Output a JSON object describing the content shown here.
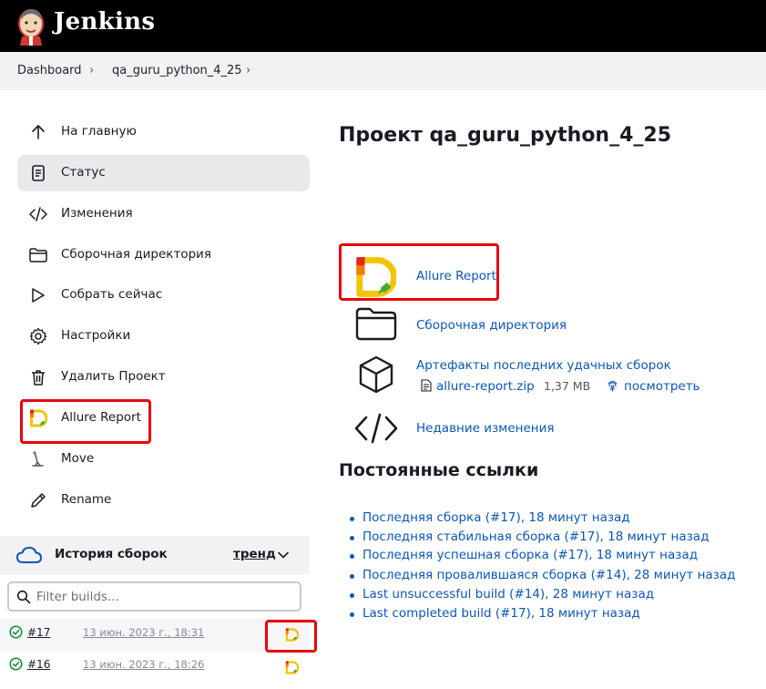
{
  "header": {
    "brand": "Jenkins"
  },
  "breadcrumb": {
    "items": [
      "Dashboard",
      "qa_guru_python_4_25"
    ]
  },
  "sidebar": {
    "items": [
      {
        "label": "На главную",
        "icon": "arrow-up-icon"
      },
      {
        "label": "Статус",
        "icon": "document-icon",
        "active": true
      },
      {
        "label": "Изменения",
        "icon": "code-icon"
      },
      {
        "label": "Сборочная директория",
        "icon": "folder-icon"
      },
      {
        "label": "Собрать сейчас",
        "icon": "play-icon"
      },
      {
        "label": "Настройки",
        "icon": "gear-icon"
      },
      {
        "label": "Удалить Проект",
        "icon": "trash-icon"
      },
      {
        "label": "Allure Report",
        "icon": "allure-icon"
      },
      {
        "label": "Move",
        "icon": "move-icon"
      },
      {
        "label": "Rename",
        "icon": "pencil-icon"
      }
    ]
  },
  "build_history": {
    "title": "История сборок",
    "trend_label": "тренд",
    "filter_placeholder": "Filter builds...",
    "builds": [
      {
        "number": "#17",
        "date": "13 июн. 2023 г., 18:31",
        "status": "success"
      },
      {
        "number": "#16",
        "date": "13 июн. 2023 г., 18:26",
        "status": "success"
      }
    ]
  },
  "main": {
    "title": "Проект qa_guru_python_4_25",
    "links": {
      "allure": "Allure Report",
      "workspace": "Сборочная директория",
      "artifacts": "Артефакты последних удачных сборок",
      "artifact_file": "allure-report.zip",
      "artifact_size": "1,37 MB",
      "artifact_view": "посмотреть",
      "changes": "Недавние изменения"
    },
    "permalinks_title": "Постоянные ссылки",
    "permalinks": [
      "Последняя сборка (#17), 18 минут назад",
      "Последняя стабильная сборка (#17), 18 минут назад",
      "Последняя успешная сборка (#17), 18 минут назад",
      "Последняя провалившаяся сборка (#14), 28 минут назад",
      "Last unsuccessful build (#14), 28 минут назад",
      "Last completed build (#17), 18 минут назад"
    ]
  },
  "colors": {
    "link": "#0b57b5",
    "highlight_box": "#e8000c",
    "success": "#138a36",
    "topbar": "#000000"
  }
}
